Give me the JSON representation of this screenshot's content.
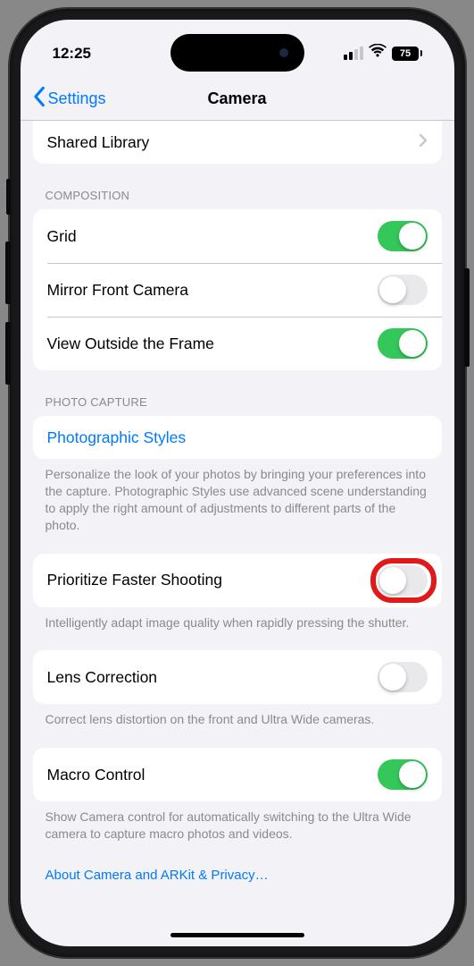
{
  "status": {
    "time": "12:25",
    "battery": "75"
  },
  "nav": {
    "back_label": "Settings",
    "title": "Camera"
  },
  "shared_library": {
    "label": "Shared Library"
  },
  "composition": {
    "header": "COMPOSITION",
    "grid": {
      "label": "Grid",
      "on": true
    },
    "mirror_front": {
      "label": "Mirror Front Camera",
      "on": false
    },
    "view_outside": {
      "label": "View Outside the Frame",
      "on": true
    }
  },
  "photo_capture": {
    "header": "PHOTO CAPTURE",
    "photographic_styles": {
      "label": "Photographic Styles",
      "footer": "Personalize the look of your photos by bringing your preferences into the capture. Photographic Styles use advanced scene understanding to apply the right amount of adjustments to different parts of the photo."
    },
    "prioritize_faster": {
      "label": "Prioritize Faster Shooting",
      "on": false,
      "footer": "Intelligently adapt image quality when rapidly pressing the shutter."
    },
    "lens_correction": {
      "label": "Lens Correction",
      "on": false,
      "footer": "Correct lens distortion on the front and Ultra Wide cameras."
    },
    "macro_control": {
      "label": "Macro Control",
      "on": true,
      "footer": "Show Camera control for automatically switching to the Ultra Wide camera to capture macro photos and videos."
    }
  },
  "privacy_link": "About Camera and ARKit & Privacy…"
}
